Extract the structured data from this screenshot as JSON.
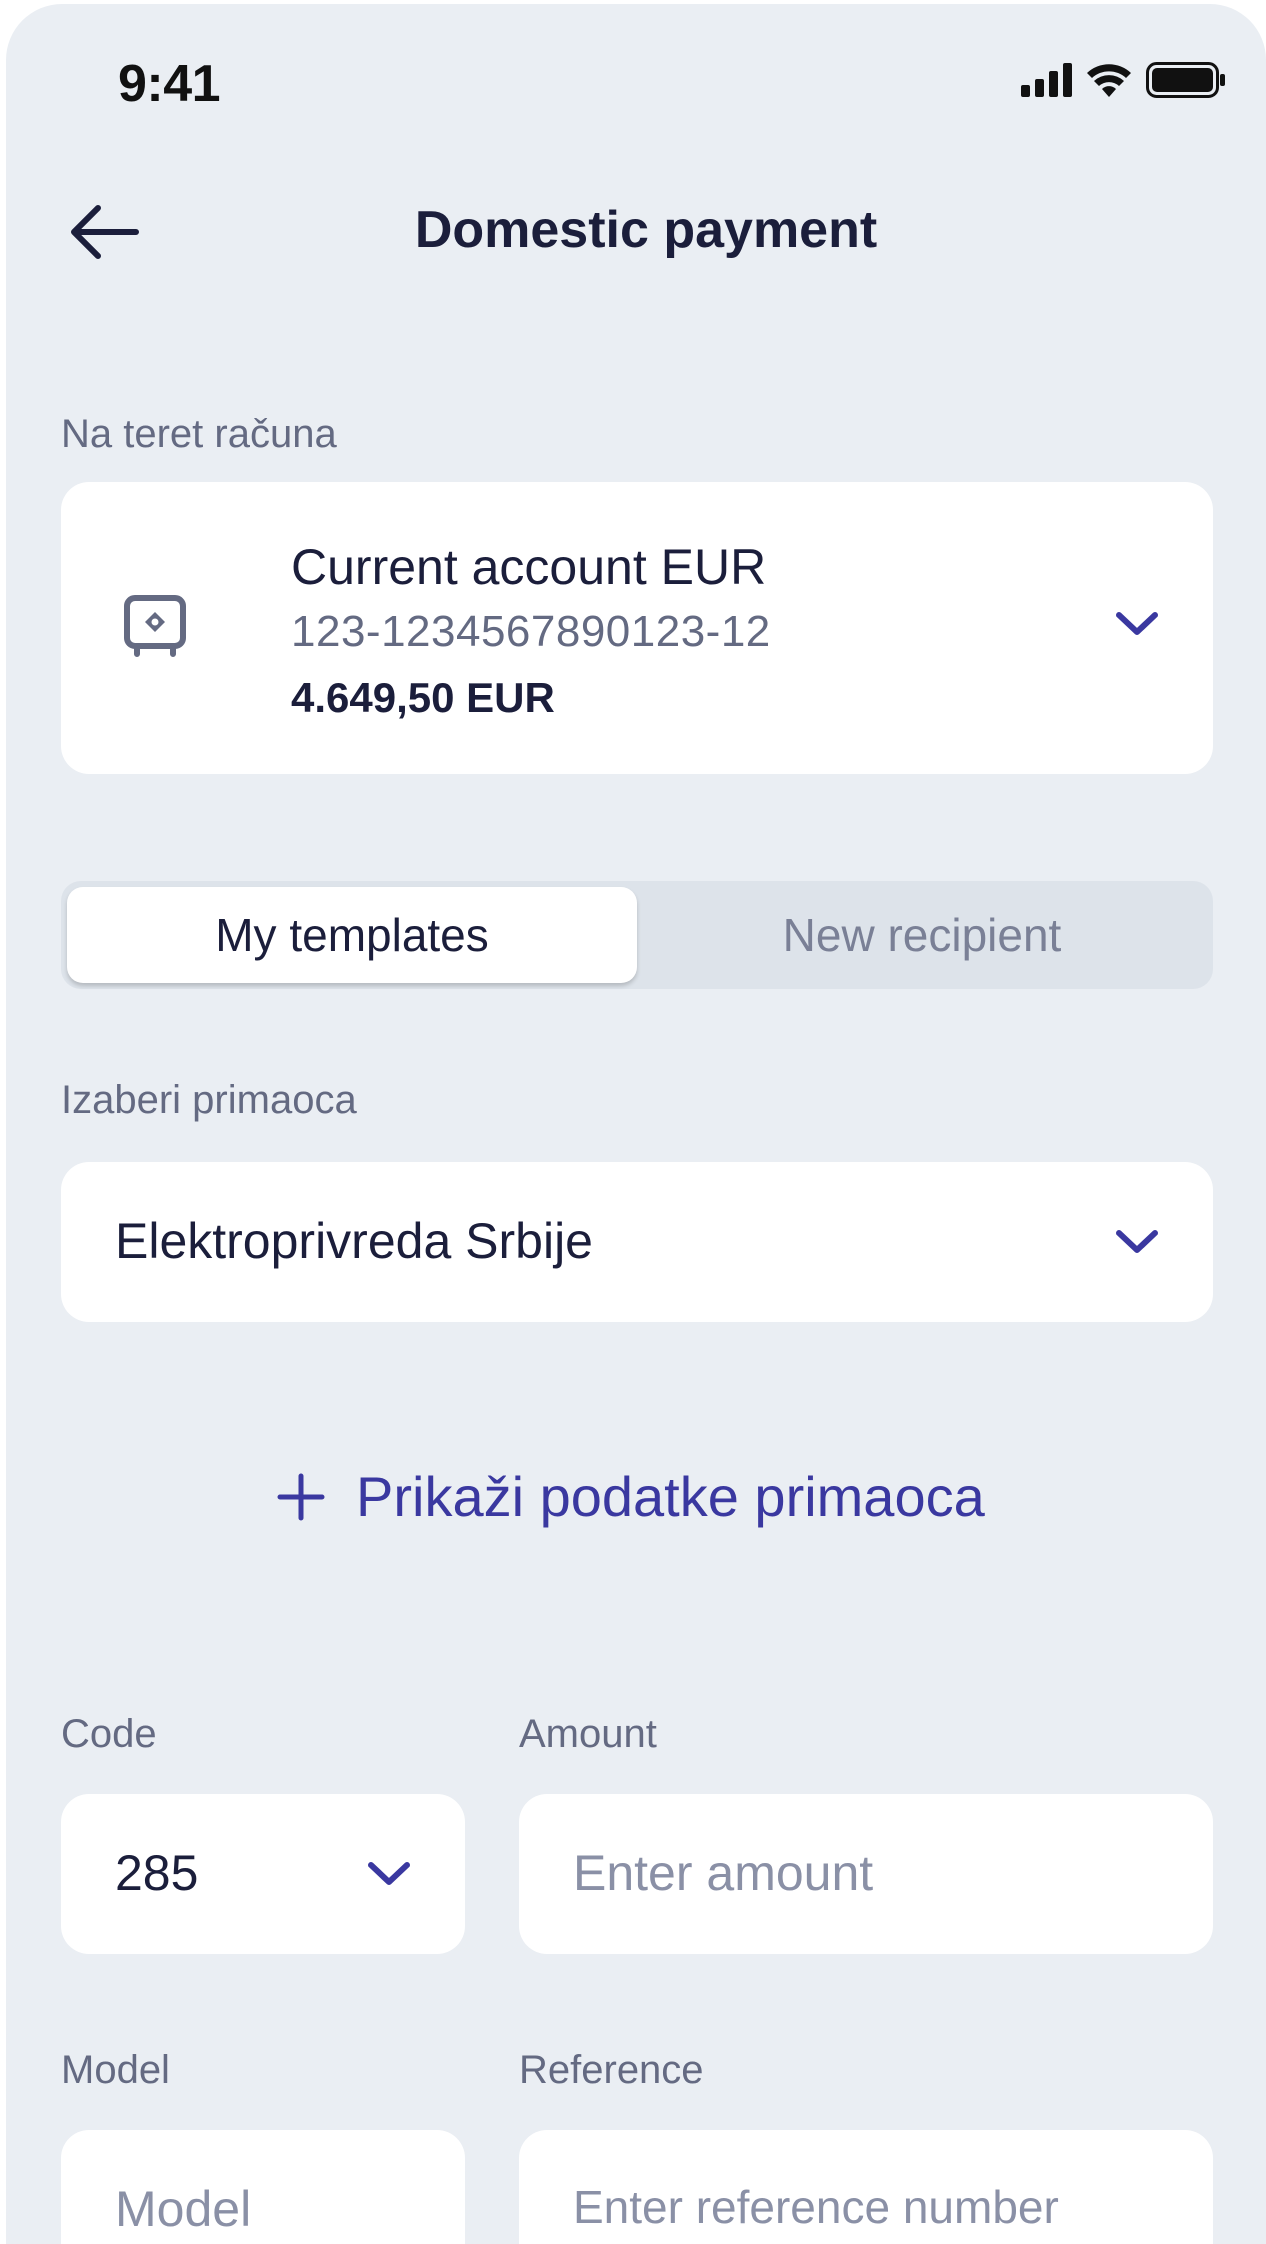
{
  "status": {
    "time": "9:41"
  },
  "header": {
    "title": "Domestic payment"
  },
  "account_section": {
    "label": "Na teret računa",
    "account_name": "Current account EUR",
    "account_number": "123-1234567890123-12",
    "balance": "4.649,50 EUR"
  },
  "tabs": [
    {
      "label": "My templates",
      "active": true
    },
    {
      "label": "New recipient",
      "active": false
    }
  ],
  "recipient": {
    "label": "Izaberi primaoca",
    "value": "Elektroprivreda Srbije"
  },
  "show_details": {
    "label": "Prikaži podatke primaoca"
  },
  "code": {
    "label": "Code",
    "value": "285"
  },
  "amount": {
    "label": "Amount",
    "placeholder": "Enter amount"
  },
  "model": {
    "label": "Model",
    "placeholder": "Model"
  },
  "reference": {
    "label": "Reference",
    "placeholder": "Enter reference number"
  },
  "colors": {
    "accent": "#3a38a0",
    "background": "#eaeef3",
    "text": "#1b1e3b",
    "muted": "#646a82"
  },
  "icons": [
    "back-arrow-icon",
    "signal-icon",
    "wifi-icon",
    "battery-icon",
    "safe-icon",
    "chevron-down-icon",
    "plus-icon"
  ]
}
